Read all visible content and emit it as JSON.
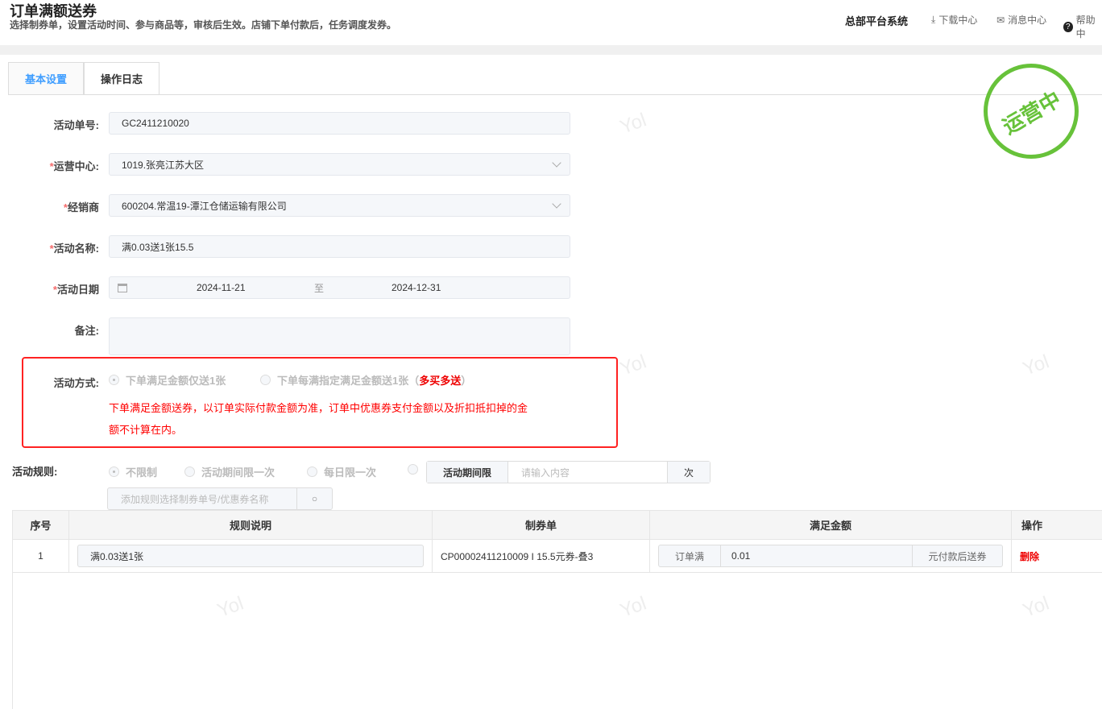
{
  "header": {
    "title": "订单满额送券",
    "subtitle": "选择制券单，设置活动时间、参与商品等，审核后生效。店铺下单付款后，任务调度发券。",
    "system": "总部平台系统",
    "download": "下载中心",
    "messages": "消息中心",
    "help": "帮助中"
  },
  "tabs": [
    "基本设置",
    "操作日志"
  ],
  "status_stamp": "运营中",
  "watermark": "Yol",
  "form": {
    "activity_no": {
      "label": "活动单号:",
      "value": "GC2411210020"
    },
    "center": {
      "label": "运营中心:",
      "value": "1019.张亮江苏大区"
    },
    "dealer": {
      "label": "经销商",
      "value": "600204.常温19-潭江仓储运输有限公司"
    },
    "name": {
      "label": "活动名称:",
      "value": "满0.03送1张15.5"
    },
    "date": {
      "label": "活动日期",
      "start": "2024-11-21",
      "sep": "至",
      "end": "2024-12-31"
    },
    "remark": {
      "label": "备注:",
      "value": ""
    },
    "mode": {
      "label": "活动方式:",
      "option1": "下单满足金额仅送1张",
      "option2": "下单每满指定满足金额送1张（",
      "option2_hl": "多买多送",
      "option2_end": "）",
      "note1": "下单满足金额送券，以订单实际付款金额为准，订单中优惠券支付金额以及折扣抵扣掉的金",
      "note2": "额不计算在内。"
    },
    "rules": {
      "label": "活动规则:",
      "opt1": "不限制",
      "opt2": "活动期间限一次",
      "opt3": "每日限一次",
      "limit_prefix": "活动期间限",
      "limit_placeholder": "请输入内容",
      "limit_suffix": "次",
      "search_placeholder": "添加规则选择制券单号/优惠券名称"
    }
  },
  "table": {
    "headers": [
      "序号",
      "规则说明",
      "制券单",
      "满足金额",
      "操作"
    ],
    "rows": [
      {
        "no": "1",
        "desc": "满0.03送1张",
        "voucher": "CP00002411210009 I 15.5元券-叠3",
        "prefix": "订单满",
        "amount": "0.01",
        "suffix": "元付款后送券",
        "action": "删除"
      }
    ]
  }
}
